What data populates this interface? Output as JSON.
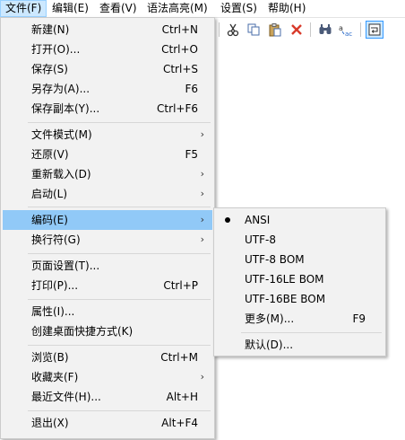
{
  "menubar": {
    "items": [
      {
        "label": "文件(F)"
      },
      {
        "label": "编辑(E)"
      },
      {
        "label": "查看(V)"
      },
      {
        "label": "语法高亮(M)"
      },
      {
        "label": "设置(S)"
      },
      {
        "label": "帮助(H)"
      }
    ]
  },
  "toolbar": {
    "icons": [
      "cut-icon",
      "copy-icon",
      "paste-icon",
      "delete-icon",
      "find-icon",
      "replace-icon",
      "word-wrap-icon"
    ]
  },
  "file_menu": {
    "items": [
      {
        "label": "新建(N)",
        "shortcut": "Ctrl+N"
      },
      {
        "label": "打开(O)...",
        "shortcut": "Ctrl+O"
      },
      {
        "label": "保存(S)",
        "shortcut": "Ctrl+S"
      },
      {
        "label": "另存为(A)...",
        "shortcut": "F6"
      },
      {
        "label": "保存副本(Y)...",
        "shortcut": "Ctrl+F6"
      },
      {
        "label": "文件模式(M)",
        "shortcut": ""
      },
      {
        "label": "还原(V)",
        "shortcut": "F5"
      },
      {
        "label": "重新载入(D)",
        "shortcut": ""
      },
      {
        "label": "启动(L)",
        "shortcut": ""
      },
      {
        "label": "编码(E)",
        "shortcut": ""
      },
      {
        "label": "换行符(G)",
        "shortcut": ""
      },
      {
        "label": "页面设置(T)...",
        "shortcut": ""
      },
      {
        "label": "打印(P)...",
        "shortcut": "Ctrl+P"
      },
      {
        "label": "属性(I)...",
        "shortcut": ""
      },
      {
        "label": "创建桌面快捷方式(K)",
        "shortcut": ""
      },
      {
        "label": "浏览(B)",
        "shortcut": "Ctrl+M"
      },
      {
        "label": "收藏夹(F)",
        "shortcut": ""
      },
      {
        "label": "最近文件(H)...",
        "shortcut": "Alt+H"
      },
      {
        "label": "退出(X)",
        "shortcut": "Alt+F4"
      }
    ],
    "submenu_arrow": "›"
  },
  "encoding_menu": {
    "items": [
      {
        "label": "ANSI",
        "shortcut": ""
      },
      {
        "label": "UTF-8",
        "shortcut": ""
      },
      {
        "label": "UTF-8 BOM",
        "shortcut": ""
      },
      {
        "label": "UTF-16LE BOM",
        "shortcut": ""
      },
      {
        "label": "UTF-16BE BOM",
        "shortcut": ""
      },
      {
        "label": "更多(M)...",
        "shortcut": "F9"
      },
      {
        "label": "默认(D)...",
        "shortcut": ""
      }
    ],
    "selected": "ANSI"
  },
  "colors": {
    "menu_bg": "#f2f2f2",
    "highlight": "#91c9f7",
    "menubar_active": "#cce8ff"
  }
}
